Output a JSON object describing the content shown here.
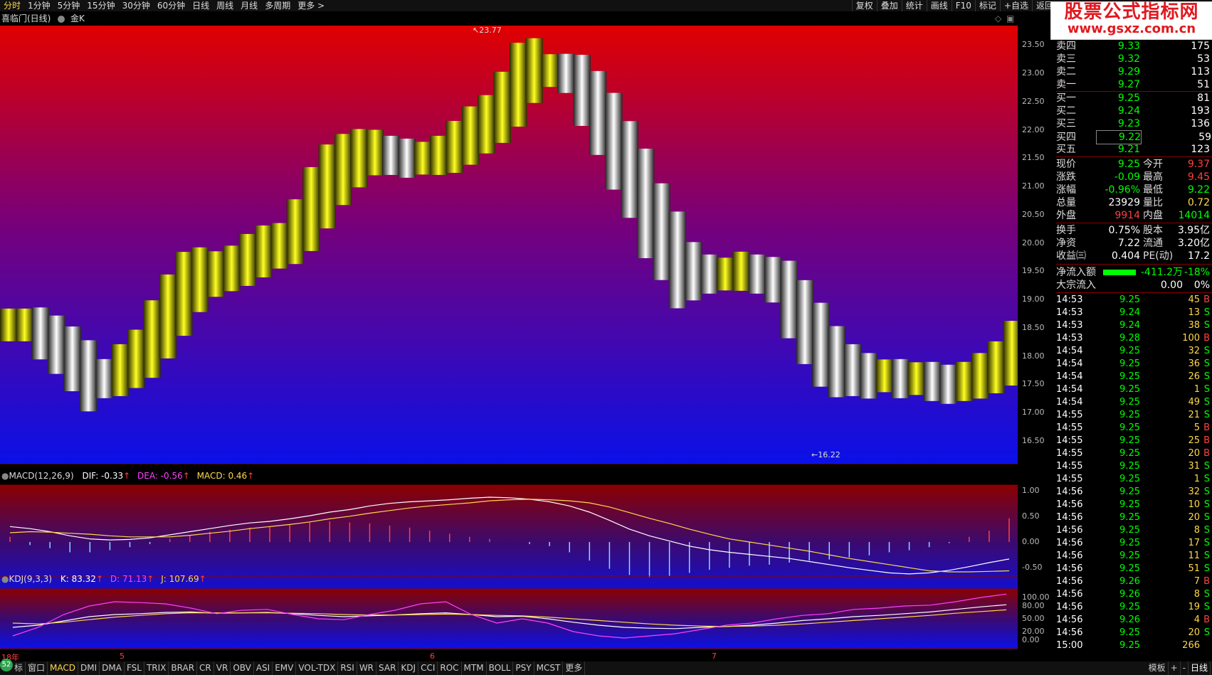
{
  "toolbar": {
    "left": [
      "分时",
      "1分钟",
      "5分钟",
      "15分钟",
      "30分钟",
      "60分钟",
      "日线",
      "周线",
      "月线",
      "多周期",
      "更多 >"
    ],
    "right": [
      "复权",
      "叠加",
      "统计",
      "画线",
      "F10",
      "标记",
      "+自选",
      "返回"
    ]
  },
  "watermark": {
    "line1": "股票公式指标网",
    "line2": "www.gsxz.com.cn"
  },
  "chart_header": {
    "title": "喜临门(日线)",
    "indicator": "金K"
  },
  "main_chart": {
    "type": "candle_band",
    "high_label": "23.77",
    "low_label": "16.22",
    "yaxis": [
      "23.50",
      "23.00",
      "22.50",
      "22.00",
      "21.50",
      "21.00",
      "20.50",
      "20.00",
      "19.50",
      "19.00",
      "18.50",
      "18.00",
      "17.50",
      "17.00",
      "16.50"
    ],
    "xlabels": [
      "18年",
      "5",
      "6",
      "7"
    ]
  },
  "macd": {
    "header": "MACD(12,26,9)",
    "dif": "DIF: -0.33",
    "dea": "DEA: -0.56",
    "macd": "MACD: 0.46",
    "yaxis": [
      "1.00",
      "0.50",
      "0.00",
      "-0.50"
    ]
  },
  "kdj": {
    "header": "KDJ(9,3,3)",
    "k": "K: 83.32",
    "d": "D: 71.13",
    "j": "J: 107.69",
    "yaxis": [
      "100.00",
      "80.00",
      "50.00",
      "20.00",
      "0.00"
    ]
  },
  "chart_data": [
    {
      "type": "line",
      "title": "喜临门(日线) 金K",
      "ylim": [
        16.22,
        23.77
      ],
      "series": [
        {
          "name": "金K",
          "values": [
            18.55,
            18.55,
            18.4,
            18.2,
            17.95,
            17.65,
            17.6,
            17.75,
            17.95,
            18.3,
            18.7,
            19.1,
            19.35,
            19.45,
            19.55,
            19.7,
            19.85,
            19.95,
            20.2,
            20.6,
            21.0,
            21.3,
            21.5,
            21.6,
            21.55,
            21.5,
            21.5,
            21.55,
            21.7,
            21.9,
            22.1,
            22.4,
            22.8,
            23.05,
            23.05,
            23.0,
            22.7,
            22.3,
            21.8,
            21.3,
            20.7,
            20.2,
            19.7,
            19.5,
            19.45,
            19.45,
            19.5,
            19.45,
            19.35,
            19.0,
            18.6,
            18.2,
            17.9,
            17.75,
            17.65,
            17.65,
            17.6,
            17.6,
            17.55,
            17.5,
            17.55,
            17.65,
            17.8,
            18.05
          ]
        }
      ]
    },
    {
      "type": "line",
      "title": "MACD(12,26,9)",
      "ylim": [
        -1.0,
        1.0
      ],
      "series": [
        {
          "name": "DIF",
          "values": [
            0.3,
            0.26,
            0.2,
            0.12,
            0.06,
            0.04,
            0.05,
            0.08,
            0.14,
            0.2,
            0.26,
            0.32,
            0.37,
            0.4,
            0.45,
            0.51,
            0.58,
            0.63,
            0.7,
            0.75,
            0.78,
            0.8,
            0.82,
            0.85,
            0.87,
            0.86,
            0.83,
            0.78,
            0.7,
            0.58,
            0.42,
            0.25,
            0.12,
            0.02,
            -0.08,
            -0.15,
            -0.2,
            -0.24,
            -0.28,
            -0.32,
            -0.38,
            -0.44,
            -0.5,
            -0.55,
            -0.6,
            -0.62,
            -0.6,
            -0.55,
            -0.48,
            -0.4,
            -0.33
          ]
        },
        {
          "name": "DEA",
          "values": [
            0.18,
            0.2,
            0.19,
            0.17,
            0.15,
            0.12,
            0.1,
            0.1,
            0.1,
            0.13,
            0.17,
            0.21,
            0.26,
            0.3,
            0.34,
            0.39,
            0.45,
            0.5,
            0.56,
            0.61,
            0.66,
            0.7,
            0.73,
            0.76,
            0.8,
            0.82,
            0.83,
            0.82,
            0.8,
            0.76,
            0.68,
            0.57,
            0.46,
            0.36,
            0.25,
            0.15,
            0.06,
            0.0,
            -0.06,
            -0.12,
            -0.18,
            -0.25,
            -0.32,
            -0.38,
            -0.44,
            -0.5,
            -0.56,
            -0.58,
            -0.58,
            -0.57,
            -0.56
          ]
        },
        {
          "name": "MACD",
          "values": [
            0.1,
            -0.06,
            -0.12,
            -0.2,
            -0.2,
            -0.16,
            -0.1,
            -0.04,
            0.06,
            0.14,
            0.2,
            0.24,
            0.28,
            0.3,
            0.34,
            0.38,
            0.4,
            0.38,
            0.36,
            0.32,
            0.28,
            0.22,
            0.16,
            0.1,
            0.06,
            0.0,
            -0.04,
            -0.08,
            -0.2,
            -0.36,
            -0.52,
            -0.64,
            -0.68,
            -0.66,
            -0.6,
            -0.54,
            -0.5,
            -0.46,
            -0.44,
            -0.4,
            -0.36,
            -0.34,
            -0.3,
            -0.26,
            -0.2,
            -0.16,
            -0.1,
            -0.02,
            0.1,
            0.22,
            0.46
          ]
        }
      ]
    },
    {
      "type": "line",
      "title": "KDJ(9,3,3)",
      "ylim": [
        0,
        100
      ],
      "series": [
        {
          "name": "K",
          "values": [
            30,
            35,
            45,
            55,
            60,
            62,
            65,
            66,
            63,
            64,
            65,
            62,
            58,
            55,
            57,
            59,
            62,
            64,
            60,
            55,
            56,
            50,
            42,
            35,
            30,
            28,
            27,
            30,
            32,
            35,
            40,
            46,
            50,
            55,
            58,
            62,
            66,
            72,
            78,
            83
          ]
        },
        {
          "name": "D",
          "values": [
            40,
            38,
            42,
            48,
            54,
            58,
            62,
            64,
            64,
            64,
            64,
            63,
            62,
            60,
            59,
            59,
            60,
            61,
            60,
            58,
            57,
            54,
            50,
            46,
            42,
            38,
            35,
            33,
            32,
            33,
            35,
            38,
            42,
            46,
            50,
            54,
            58,
            63,
            67,
            71
          ]
        },
        {
          "name": "J",
          "values": [
            10,
            30,
            60,
            80,
            90,
            88,
            85,
            75,
            62,
            70,
            72,
            60,
            50,
            48,
            60,
            70,
            85,
            90,
            60,
            40,
            50,
            40,
            20,
            10,
            5,
            10,
            15,
            25,
            35,
            40,
            50,
            58,
            62,
            72,
            75,
            80,
            82,
            90,
            100,
            108
          ]
        }
      ]
    }
  ],
  "quote_book": [
    {
      "label": "卖四",
      "price": "9.33",
      "vol": "175"
    },
    {
      "label": "卖三",
      "price": "9.32",
      "vol": "53"
    },
    {
      "label": "卖二",
      "price": "9.29",
      "vol": "113"
    },
    {
      "label": "卖一",
      "price": "9.27",
      "vol": "51"
    },
    {
      "label": "买一",
      "price": "9.25",
      "vol": "81"
    },
    {
      "label": "买二",
      "price": "9.24",
      "vol": "193"
    },
    {
      "label": "买三",
      "price": "9.23",
      "vol": "136"
    },
    {
      "label": "买四",
      "price": "9.22",
      "vol": "59"
    },
    {
      "label": "买五",
      "price": "9.21",
      "vol": "123"
    }
  ],
  "stats": [
    {
      "l1": "现价",
      "v1": "9.25",
      "l2": "今开",
      "v2": "9.37",
      "c1": "pg",
      "c2": "pr"
    },
    {
      "l1": "涨跌",
      "v1": "-0.09",
      "l2": "最高",
      "v2": "9.45",
      "c1": "pg",
      "c2": "pr"
    },
    {
      "l1": "涨幅",
      "v1": "-0.96%",
      "l2": "最低",
      "v2": "9.22",
      "c1": "pg",
      "c2": "pg"
    },
    {
      "l1": "总量",
      "v1": "23929",
      "l2": "量比",
      "v2": "0.72",
      "c1": "pw",
      "c2": "py"
    },
    {
      "l1": "外盘",
      "v1": "9914",
      "l2": "内盘",
      "v2": "14014",
      "c1": "pr",
      "c2": "pg"
    },
    {
      "l1": "换手",
      "v1": "0.75%",
      "l2": "股本",
      "v2": "3.95亿",
      "c1": "pw",
      "c2": "pw"
    },
    {
      "l1": "净资",
      "v1": "7.22",
      "l2": "流通",
      "v2": "3.20亿",
      "c1": "pw",
      "c2": "pw"
    },
    {
      "l1": "收益㈢",
      "v1": "0.404",
      "l2": "PE(动)",
      "v2": "17.2",
      "c1": "pw",
      "c2": "pw"
    }
  ],
  "flow": {
    "l1": "净流入额",
    "v1": "-411.2万",
    "p1": "-18%",
    "l2": "大宗流入",
    "v2": "0.00",
    "p2": "0%"
  },
  "ticks": [
    {
      "t": "14:53",
      "p": "9.25",
      "v": "45",
      "s": "B"
    },
    {
      "t": "14:53",
      "p": "9.24",
      "v": "13",
      "s": "S"
    },
    {
      "t": "14:53",
      "p": "9.24",
      "v": "38",
      "s": "S"
    },
    {
      "t": "14:53",
      "p": "9.28",
      "v": "100",
      "s": "B"
    },
    {
      "t": "14:54",
      "p": "9.25",
      "v": "32",
      "s": "S"
    },
    {
      "t": "14:54",
      "p": "9.25",
      "v": "36",
      "s": "S"
    },
    {
      "t": "14:54",
      "p": "9.25",
      "v": "26",
      "s": "S"
    },
    {
      "t": "14:54",
      "p": "9.25",
      "v": "1",
      "s": "S"
    },
    {
      "t": "14:54",
      "p": "9.25",
      "v": "49",
      "s": "S"
    },
    {
      "t": "14:55",
      "p": "9.25",
      "v": "21",
      "s": "S"
    },
    {
      "t": "14:55",
      "p": "9.25",
      "v": "5",
      "s": "B"
    },
    {
      "t": "14:55",
      "p": "9.25",
      "v": "25",
      "s": "B"
    },
    {
      "t": "14:55",
      "p": "9.25",
      "v": "20",
      "s": "B"
    },
    {
      "t": "14:55",
      "p": "9.25",
      "v": "31",
      "s": "S"
    },
    {
      "t": "14:55",
      "p": "9.25",
      "v": "1",
      "s": "S"
    },
    {
      "t": "14:56",
      "p": "9.25",
      "v": "32",
      "s": "S"
    },
    {
      "t": "14:56",
      "p": "9.25",
      "v": "10",
      "s": "S"
    },
    {
      "t": "14:56",
      "p": "9.25",
      "v": "20",
      "s": "S"
    },
    {
      "t": "14:56",
      "p": "9.25",
      "v": "8",
      "s": "S"
    },
    {
      "t": "14:56",
      "p": "9.25",
      "v": "17",
      "s": "S"
    },
    {
      "t": "14:56",
      "p": "9.25",
      "v": "11",
      "s": "S"
    },
    {
      "t": "14:56",
      "p": "9.25",
      "v": "51",
      "s": "S"
    },
    {
      "t": "14:56",
      "p": "9.26",
      "v": "7",
      "s": "B"
    },
    {
      "t": "14:56",
      "p": "9.26",
      "v": "8",
      "s": "S"
    },
    {
      "t": "14:56",
      "p": "9.25",
      "v": "19",
      "s": "S"
    },
    {
      "t": "14:56",
      "p": "9.26",
      "v": "4",
      "s": "B"
    },
    {
      "t": "14:56",
      "p": "9.25",
      "v": "20",
      "s": "S"
    },
    {
      "t": "15:00",
      "p": "9.25",
      "v": "266",
      "s": ""
    }
  ],
  "bottom_tabs": [
    "标",
    "窗口",
    "MACD",
    "DMI",
    "DMA",
    "FSL",
    "TRIX",
    "BRAR",
    "CR",
    "VR",
    "OBV",
    "ASI",
    "EMV",
    "VOL-TDX",
    "RSI",
    "WR",
    "SAR",
    "KDJ",
    "CCI",
    "ROC",
    "MTM",
    "BOLL",
    "PSY",
    "MCST",
    "更多"
  ],
  "bottom_right": {
    "template": "模板",
    "plus": "+",
    "minus": "-",
    "period": "日线"
  },
  "badge": "52",
  "colors": {
    "up": "#ff4040",
    "down": "#00ff00",
    "gold": "#ffd84a"
  }
}
